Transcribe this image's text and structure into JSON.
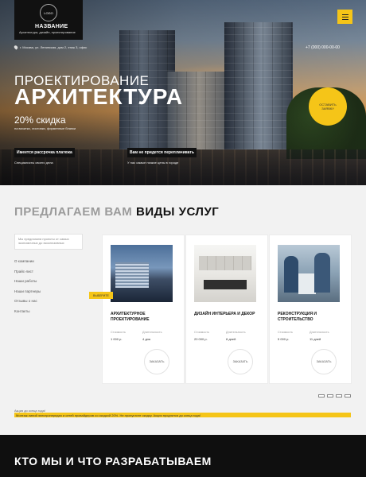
{
  "header": {
    "logo_text": "LOGO",
    "brand_name": "НАЗВАНИЕ",
    "brand_sub": "Архитектура, дизайн, проектирование",
    "address": "г. Москва, ул. Ленинская, дом 2, этаж 3, офис",
    "phone": "+7 (000) 000-00-00",
    "menu_icon": "hamburger-icon"
  },
  "hero": {
    "title_line1": "ПРОЕКТИРОВАНИЕ",
    "title_line2": "АРХИТЕКТУРА",
    "discount": "20% скидка",
    "discount_note": "на визитки, листовки, фирменные бланки",
    "cta": "ОСТАВИТЬ ЗАЯВКУ",
    "features": [
      {
        "label": "Имеется рассрочка платежа",
        "sub": "Специалисты своего дела"
      },
      {
        "label": "Вам не придется переплачивать",
        "sub": "У нас самые низкие цены в городе"
      }
    ]
  },
  "services": {
    "title_gray": "ПРЕДЛАГАЕМ ВАМ",
    "title_dark": "ВИДЫ УСЛУГ",
    "search_text": "Мы предлагаем проекты от самых экономичных до эксклюзивных",
    "nav": [
      "О компании",
      "Прайс-лист",
      "Наши работы",
      "Наши партнеры",
      "Отзывы о нас",
      "Контакты"
    ],
    "tag": "ВЫБЕРИТЕ",
    "cards": [
      {
        "title": "АРХИТЕКТУРНОЕ ПРОЕКТИРОВАНИЕ",
        "cost_label": "Стоимость",
        "cost": "1 000 р.",
        "dur_label": "Длительность",
        "dur": "4 дня",
        "order": "ЗАКАЗАТЬ"
      },
      {
        "title": "ДИЗАЙН ИНТЕРЬЕРА И ДЕКОР",
        "cost_label": "Стоимость",
        "cost": "20 000 р.",
        "dur_label": "Длительность",
        "dur": "8 дней",
        "order": "ЗАКАЗАТЬ"
      },
      {
        "title": "РЕКОНСТРУКЦИЯ И СТРОИТЕЛЬСТВО",
        "cost_label": "Стоимость",
        "cost": "5 000 р.",
        "dur_label": "Длительность",
        "dur": "11 дней",
        "order": "ЗАКАЗАТЬ"
      }
    ]
  },
  "promo": {
    "label": "Акция до конца года!",
    "text": "Монтаж линий электропередач и сетей провайдеров со скидкой 20%. Не пропустите скидку. Акция продлится до конца года!"
  },
  "footer": {
    "title_white": "КТО МЫ И ЧТО",
    "title_bold": "РАЗРАБАТЫВАЕМ"
  },
  "colors": {
    "accent": "#f5c518",
    "dark": "#0f0f0f"
  }
}
